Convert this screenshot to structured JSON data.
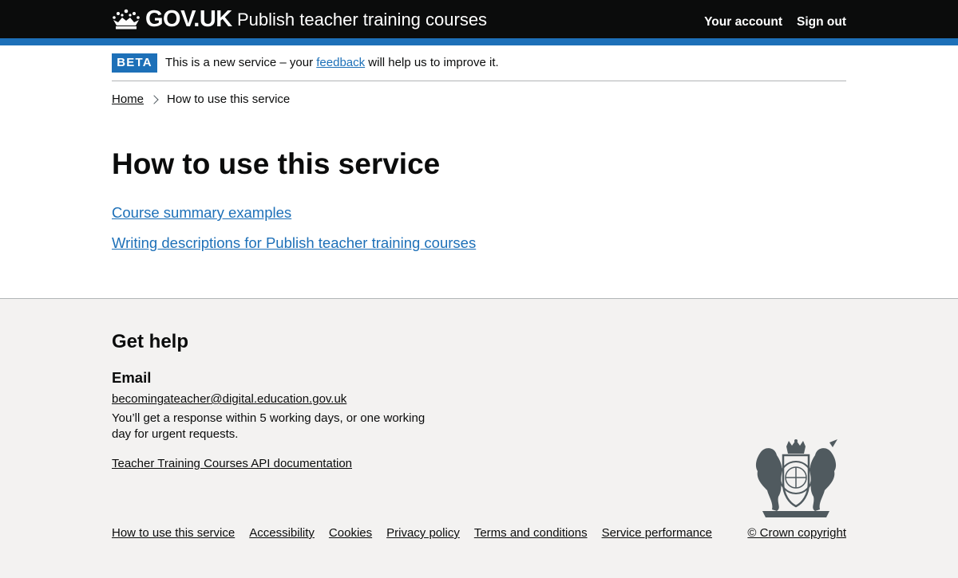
{
  "header": {
    "logo_text": "GOV.UK",
    "service_name": "Publish teacher training courses",
    "nav": [
      {
        "label": "Your account"
      },
      {
        "label": "Sign out"
      }
    ]
  },
  "phase_banner": {
    "tag": "BETA",
    "text_before": "This is a new service – your ",
    "link": "feedback",
    "text_after": " will help us to improve it."
  },
  "breadcrumbs": [
    {
      "label": "Home"
    },
    {
      "label": "How to use this service"
    }
  ],
  "main": {
    "title": "How to use this service",
    "links": [
      {
        "label": "Course summary examples"
      },
      {
        "label": "Writing descriptions for Publish teacher training courses"
      }
    ]
  },
  "footer": {
    "help_title": "Get help",
    "email_title": "Email",
    "email": "becomingateacher@digital.education.gov.uk",
    "email_note": "You’ll get a response within 5 working days, or one working day for urgent requests.",
    "api_link": "Teacher Training Courses API documentation",
    "links": [
      {
        "label": "How to use this service"
      },
      {
        "label": "Accessibility"
      },
      {
        "label": "Cookies"
      },
      {
        "label": "Privacy policy"
      },
      {
        "label": "Terms and conditions"
      },
      {
        "label": "Service performance"
      }
    ],
    "copyright": "© Crown copyright"
  },
  "colors": {
    "header_bg": "#0b0c0c",
    "accent_blue": "#1d70b8",
    "link_blue": "#1d70b8",
    "footer_bg": "#f3f2f1",
    "text": "#0b0c0c"
  },
  "icons": {
    "logo": "crown-icon",
    "breadcrumb_separator": "chevron-right-icon",
    "footer_crest": "royal-coat-of-arms-icon"
  }
}
